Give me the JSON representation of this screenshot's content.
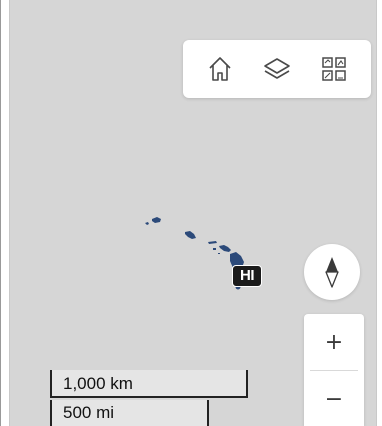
{
  "toolbar": {
    "buttons": [
      {
        "name": "home",
        "icon": "home-icon"
      },
      {
        "name": "layers",
        "icon": "layers-icon"
      },
      {
        "name": "basemap",
        "icon": "basemap-gallery-icon"
      }
    ]
  },
  "map": {
    "background_color": "#d6d6d6",
    "island_color": "#2c4a7a",
    "state_label": "HI"
  },
  "controls": {
    "compass_icon": "compass-icon",
    "zoom_in_label": "+",
    "zoom_out_label": "−"
  },
  "scalebar": {
    "km_label": "1,000 km",
    "mi_label": "500 mi"
  }
}
